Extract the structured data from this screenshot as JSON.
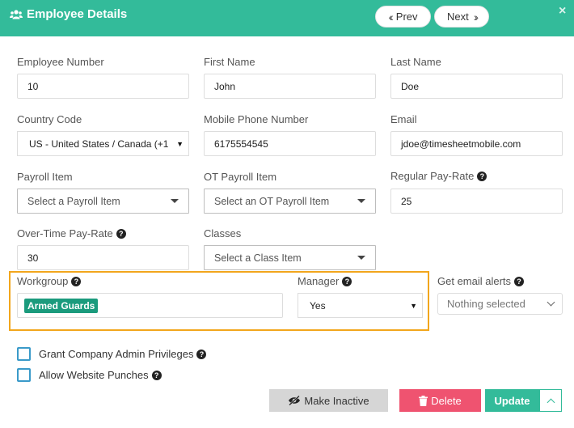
{
  "header": {
    "title": "Employee Details",
    "prev_label": "Prev",
    "next_label": "Next",
    "close_icon": "×"
  },
  "fields": {
    "employee_number": {
      "label": "Employee Number",
      "value": "10"
    },
    "first_name": {
      "label": "First Name",
      "value": "John"
    },
    "last_name": {
      "label": "Last Name",
      "value": "Doe"
    },
    "country_code": {
      "label": "Country Code",
      "value": "US - United States / Canada (+1"
    },
    "mobile_phone": {
      "label": "Mobile Phone Number",
      "value": "6175554545"
    },
    "email": {
      "label": "Email",
      "value": "jdoe@timesheetmobile.com"
    },
    "payroll_item": {
      "label": "Payroll Item",
      "placeholder": "Select a Payroll Item"
    },
    "ot_payroll_item": {
      "label": "OT Payroll Item",
      "placeholder": "Select an OT Payroll Item"
    },
    "regular_pay_rate": {
      "label": "Regular Pay-Rate",
      "value": "25"
    },
    "overtime_pay_rate": {
      "label": "Over-Time Pay-Rate",
      "value": "30"
    },
    "classes": {
      "label": "Classes",
      "placeholder": "Select a Class Item"
    },
    "workgroup": {
      "label": "Workgroup",
      "tag": "Armed Guards"
    },
    "manager": {
      "label": "Manager",
      "value": "Yes"
    },
    "email_alerts": {
      "label": "Get email alerts",
      "value": "Nothing selected"
    }
  },
  "checkboxes": {
    "admin": "Grant Company Admin Privileges",
    "website_punches": "Allow Website Punches"
  },
  "buttons": {
    "make_inactive": "Make Inactive",
    "delete": "Delete",
    "update": "Update"
  },
  "colors": {
    "accent": "#33bb9a",
    "delete": "#ef5370",
    "tag": "#1b9b7d",
    "highlight": "#f2a61c"
  }
}
